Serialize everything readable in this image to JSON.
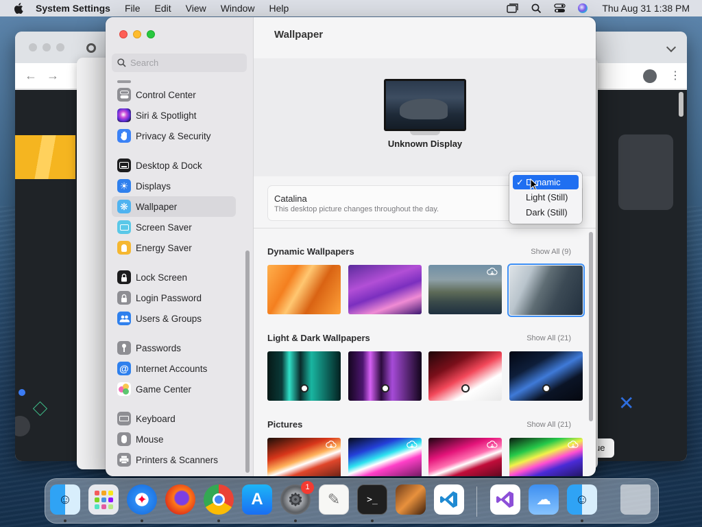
{
  "menubar": {
    "app_name": "System Settings",
    "menus": [
      "File",
      "Edit",
      "View",
      "Window",
      "Help"
    ],
    "clock": "Thu Aug 31  1:38 PM"
  },
  "sidebar": {
    "search_placeholder": "Search",
    "items": [
      {
        "label": "Control Center",
        "icon": "control-center-icon",
        "color": "#8e8e93"
      },
      {
        "label": "Siri & Spotlight",
        "icon": "siri-icon",
        "color": "#9c3cd6"
      },
      {
        "label": "Privacy & Security",
        "icon": "hand-icon",
        "color": "#3b82f6"
      },
      {
        "label": "Desktop & Dock",
        "icon": "dock-icon",
        "color": "#1c1c1e"
      },
      {
        "label": "Displays",
        "icon": "sun-icon",
        "color": "#2f80ed"
      },
      {
        "label": "Wallpaper",
        "icon": "wallpaper-icon",
        "color": "#4fb3f0"
      },
      {
        "label": "Screen Saver",
        "icon": "screen-saver-icon",
        "color": "#5ac8e8"
      },
      {
        "label": "Energy Saver",
        "icon": "bulb-icon",
        "color": "#f5b731"
      },
      {
        "label": "Lock Screen",
        "icon": "lock-icon",
        "color": "#1c1c1e"
      },
      {
        "label": "Login Password",
        "icon": "login-lock-icon",
        "color": "#8e8e93"
      },
      {
        "label": "Users & Groups",
        "icon": "users-icon",
        "color": "#2f80ed"
      },
      {
        "label": "Passwords",
        "icon": "key-icon",
        "color": "#8e8e93"
      },
      {
        "label": "Internet Accounts",
        "icon": "at-icon",
        "color": "#2f80ed"
      },
      {
        "label": "Game Center",
        "icon": "game-center-icon",
        "color": "#ffffff"
      },
      {
        "label": "Keyboard",
        "icon": "keyboard-icon",
        "color": "#8e8e93"
      },
      {
        "label": "Mouse",
        "icon": "mouse-icon",
        "color": "#8e8e93"
      },
      {
        "label": "Printers & Scanners",
        "icon": "printer-icon",
        "color": "#8e8e93"
      }
    ]
  },
  "main": {
    "title": "Wallpaper",
    "display_name": "Unknown Display",
    "wallpaper_name": "Catalina",
    "wallpaper_desc": "This desktop picture changes throughout the day.",
    "mode_options": [
      "Dynamic",
      "Light (Still)",
      "Dark (Still)"
    ],
    "selected_mode": "Dynamic",
    "sections": [
      {
        "title": "Dynamic Wallpapers",
        "show_all": "Show All (9)"
      },
      {
        "title": "Light & Dark Wallpapers",
        "show_all": "Show All (21)"
      },
      {
        "title": "Pictures",
        "show_all": "Show All (21)"
      }
    ]
  },
  "dock": {
    "apps": [
      "Finder",
      "Launchpad",
      "Safari",
      "Firefox",
      "Chrome",
      "App Store",
      "System Settings",
      "TextEdit",
      "Terminal",
      "GarageBand",
      "Visual Studio Code",
      "Visual Studio",
      "Weather",
      "Migration Assistant",
      "Trash"
    ],
    "system_settings_badge": "1"
  },
  "background_button": "ue",
  "colors": {
    "accent": "#1f6ff1",
    "selection": "#3d8ff5"
  }
}
